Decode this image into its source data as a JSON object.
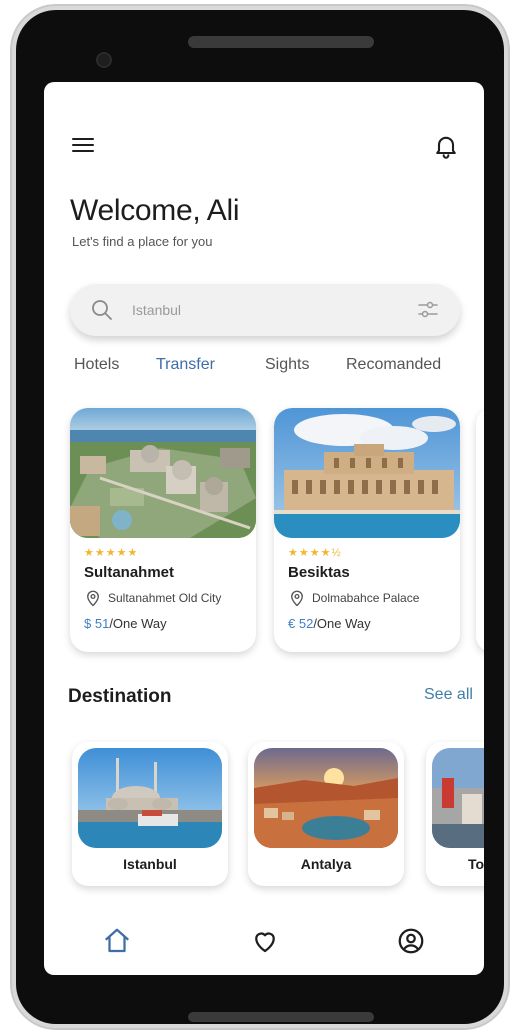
{
  "header": {
    "greeting": "Welcome, Ali",
    "subtitle": "Let's find a place for you"
  },
  "search": {
    "placeholder": "Istanbul"
  },
  "tabs": [
    {
      "label": "Hotels",
      "active": false
    },
    {
      "label": "Transfer",
      "active": true
    },
    {
      "label": "Sights",
      "active": false
    },
    {
      "label": "Recomanded",
      "active": false
    }
  ],
  "cards": [
    {
      "rating": 5,
      "stars": "★★★★★",
      "title": "Sultanahmet",
      "location": "Sultanahmet Old City",
      "price": "$ 51",
      "price_suffix": "/One Way"
    },
    {
      "rating": 4.5,
      "stars": "★★★★½",
      "title": "Besiktas",
      "location": "Dolmabahce Palace",
      "price": "€ 52",
      "price_suffix": "/One Way"
    }
  ],
  "destination": {
    "title": "Destination",
    "see_all": "See all",
    "items": [
      {
        "label": "Istanbul"
      },
      {
        "label": "Antalya"
      },
      {
        "label": "To"
      }
    ]
  },
  "colors": {
    "accent": "#3f6da6",
    "price": "#3f7fc4",
    "stars": "#f2b632"
  },
  "icons": {
    "menu": "menu-icon",
    "bell": "bell-icon",
    "search": "search-icon",
    "filter": "filter-icon",
    "location": "location-pin-icon",
    "home": "home-icon",
    "heart": "heart-icon",
    "profile": "profile-icon"
  }
}
